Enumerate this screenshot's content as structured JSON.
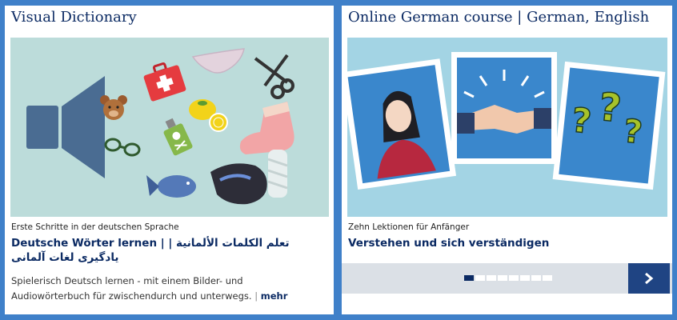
{
  "visual_dictionary": {
    "title": "Visual Dictionary",
    "kicker": "Erste Schritte in der deutschen Sprache",
    "headline": "Deutsche Wörter lernen | تعلم الكلمات الألمانية | یادگیری لغات آلمانی",
    "description": "Spielerisch Deutsch lernen - mit einem Bilder- und Audiowörterbuch für zwischendurch und unterwegs.",
    "separator": "|",
    "more_label": "mehr"
  },
  "german_course": {
    "title": "Online German course | German, English",
    "kicker": "Zehn Lektionen für Anfänger",
    "headline": "Verstehen und sich verständigen",
    "carousel": {
      "total": 8,
      "active_index": 0
    }
  },
  "colors": {
    "page_background": "#3f80c9",
    "heading": "#0b2a63",
    "nav_button": "#1f4483",
    "left_illustration_bg": "#bcdcda",
    "right_illustration_bg": "#a3d4e4"
  },
  "icons": [
    "speaker-icon",
    "teddy-bear-icon",
    "first-aid-kit-icon",
    "underwear-icon",
    "scissors-icon",
    "glasses-icon",
    "poison-bottle-icon",
    "lemon-icon",
    "sock-icon",
    "fish-icon",
    "shoe-icon",
    "bandaged-foot-icon",
    "chevron-right-icon"
  ]
}
